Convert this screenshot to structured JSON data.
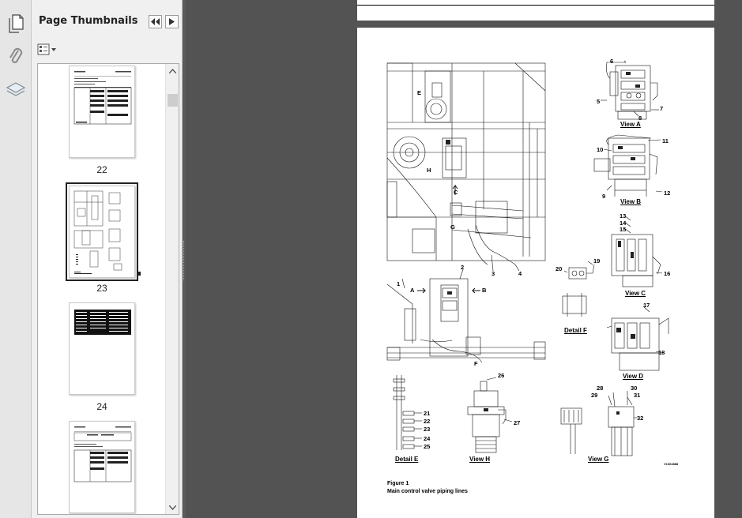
{
  "sidebar": {
    "icons": [
      "page-thumbnails-icon",
      "attachments-icon",
      "layers-icon"
    ]
  },
  "panel": {
    "title": "Page Thumbnails",
    "options_icon": "options-menu-icon",
    "thumbnails": [
      {
        "label": "22",
        "selected": false
      },
      {
        "label": "23",
        "selected": true
      },
      {
        "label": "24",
        "selected": false
      },
      {
        "label": "",
        "selected": false
      }
    ]
  },
  "figure": {
    "caption_line1": "Figure 1",
    "caption_line2": "Main control valve piping lines",
    "ref_code": "V1063888"
  },
  "views": {
    "view_a": "View  A",
    "view_b": "View  B",
    "view_c": "View  C",
    "view_d": "View  D",
    "detail_f": "Detail  F",
    "detail_e": "Detail  E",
    "view_h": "View  H",
    "view_g": "View  G"
  },
  "callouts": {
    "c1": "1",
    "c2": "2",
    "c3": "3",
    "c4": "4",
    "c5": "5",
    "c6": "6",
    "c7": "7",
    "c8": "8",
    "c9": "9",
    "c10": "10",
    "c11": "11",
    "c12": "12",
    "c13": "13",
    "c14": "14",
    "c15": "15",
    "c16": "16",
    "c17": "17",
    "c18": "18",
    "c19": "19",
    "c20": "20",
    "c21": "21",
    "c22": "22",
    "c23": "23",
    "c24": "24",
    "c25": "25",
    "c26": "26",
    "c27": "27",
    "c28": "28",
    "c29": "29",
    "c30": "30",
    "c31": "31",
    "c32": "32"
  },
  "markers": {
    "a": "A",
    "b": "B",
    "c": "C",
    "e": "E",
    "f": "F",
    "g": "G",
    "h": "H"
  }
}
